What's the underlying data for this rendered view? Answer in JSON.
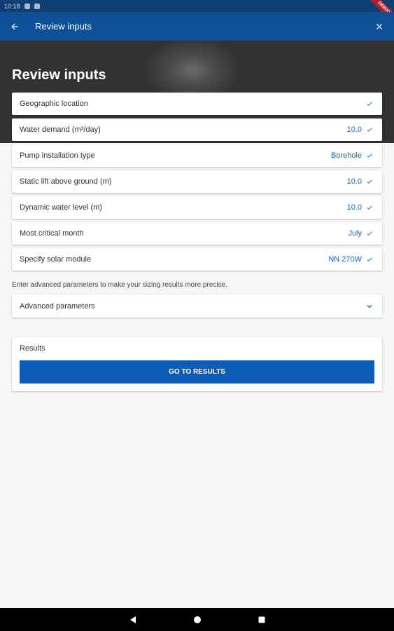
{
  "status_bar": {
    "time": "10:18"
  },
  "debug_banner": "DEBUG",
  "app_bar": {
    "title": "Review inputs",
    "back_icon": "arrow-back-icon",
    "close_icon": "close-icon"
  },
  "header": {
    "title": "Review inputs"
  },
  "inputs": [
    {
      "label": "Geographic location",
      "value": ""
    },
    {
      "label": "Water demand (m³/day)",
      "value": "10.0"
    },
    {
      "label": "Pump installation type",
      "value": "Borehole"
    },
    {
      "label": "Static lift above ground (m)",
      "value": "10.0"
    },
    {
      "label": "Dynamic water level (m)",
      "value": "10.0"
    },
    {
      "label": "Most critical month",
      "value": "July"
    },
    {
      "label": "Specify solar module",
      "value": "NN 270W"
    }
  ],
  "hint_text": "Enter advanced parameters to make your sizing results more precise.",
  "advanced": {
    "label": "Advanced parameters",
    "icon": "chevron-down-icon"
  },
  "results": {
    "label": "Results",
    "button_label": "GO TO RESULTS"
  },
  "colors": {
    "app_bar": "#0f5199",
    "accent": "#1565c0",
    "button": "#0d5db8",
    "header": "#3a3a3a"
  }
}
